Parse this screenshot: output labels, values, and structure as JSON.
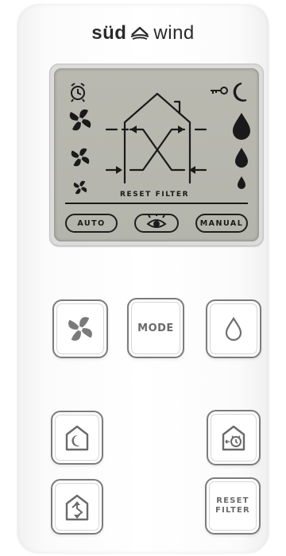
{
  "brand": {
    "left": "süd",
    "right": "wind"
  },
  "display": {
    "reset_filter_label": "RESET FILTER",
    "mode_pills": [
      "AUTO",
      "MANUAL"
    ]
  },
  "buttons": {
    "mode_label": "MODE",
    "reset_filter_line1": "RESET",
    "reset_filter_line2": "FILTER"
  },
  "colors": {
    "lcd_background": "#b6b7ae",
    "lcd_segment": "#1a1a1a",
    "button_border": "#7c7c7c",
    "button_text": "#6a6a6a"
  },
  "icons": {
    "lcd": [
      "alarm-clock-icon",
      "key-icon",
      "moon-icon",
      "fan-high-icon",
      "fan-medium-icon",
      "fan-low-icon",
      "drop-large-icon",
      "drop-medium-icon",
      "drop-small-icon",
      "house-airflow-icon",
      "eye-icon"
    ],
    "buttons": [
      "fan-icon",
      "drop-icon",
      "night-mode-icon",
      "timer-icon",
      "ventilation-icon"
    ]
  }
}
